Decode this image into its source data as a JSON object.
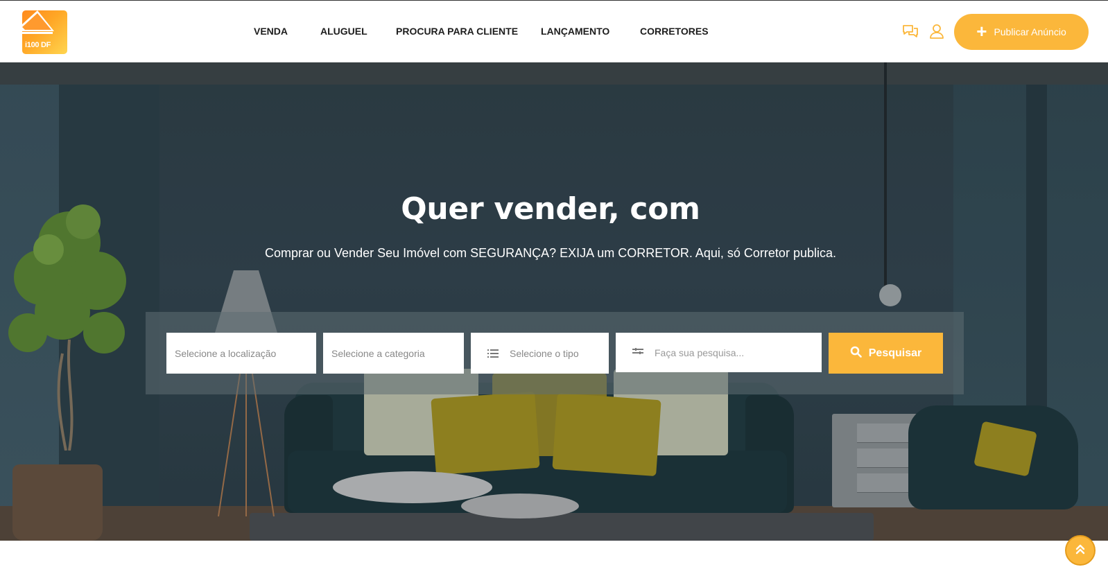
{
  "brand": {
    "logo_text": "i100 DF",
    "accent": "#fbb73b",
    "logo_gradient": [
      "#ff8a1e",
      "#ffd54f"
    ]
  },
  "nav": {
    "items": [
      {
        "label": "VENDA"
      },
      {
        "label": "ALUGUEL"
      },
      {
        "label": "PROCURA PARA CLIENTE"
      },
      {
        "label": "LANÇAMENTO"
      },
      {
        "label": "CORRETORES"
      }
    ]
  },
  "header": {
    "icons": [
      "chat-icon",
      "user-icon"
    ],
    "publish_label": "Publicar Anúncio"
  },
  "hero": {
    "title": "Quer vender, com",
    "subtitle": "Comprar ou Vender Seu Imóvel com SEGURANÇA? EXIJA um CORRETOR. Aqui, só Corretor publica."
  },
  "search": {
    "location_placeholder": "Selecione a localização",
    "category_placeholder": "Selecione a categoria",
    "type_placeholder": "Selecione o tipo",
    "query_placeholder": "Faça sua pesquisa...",
    "button_label": "Pesquisar",
    "icons": [
      "list-icon",
      "filter-icon",
      "search-icon"
    ]
  },
  "scroll_top": {
    "icon": "double-chevron-up-icon"
  }
}
